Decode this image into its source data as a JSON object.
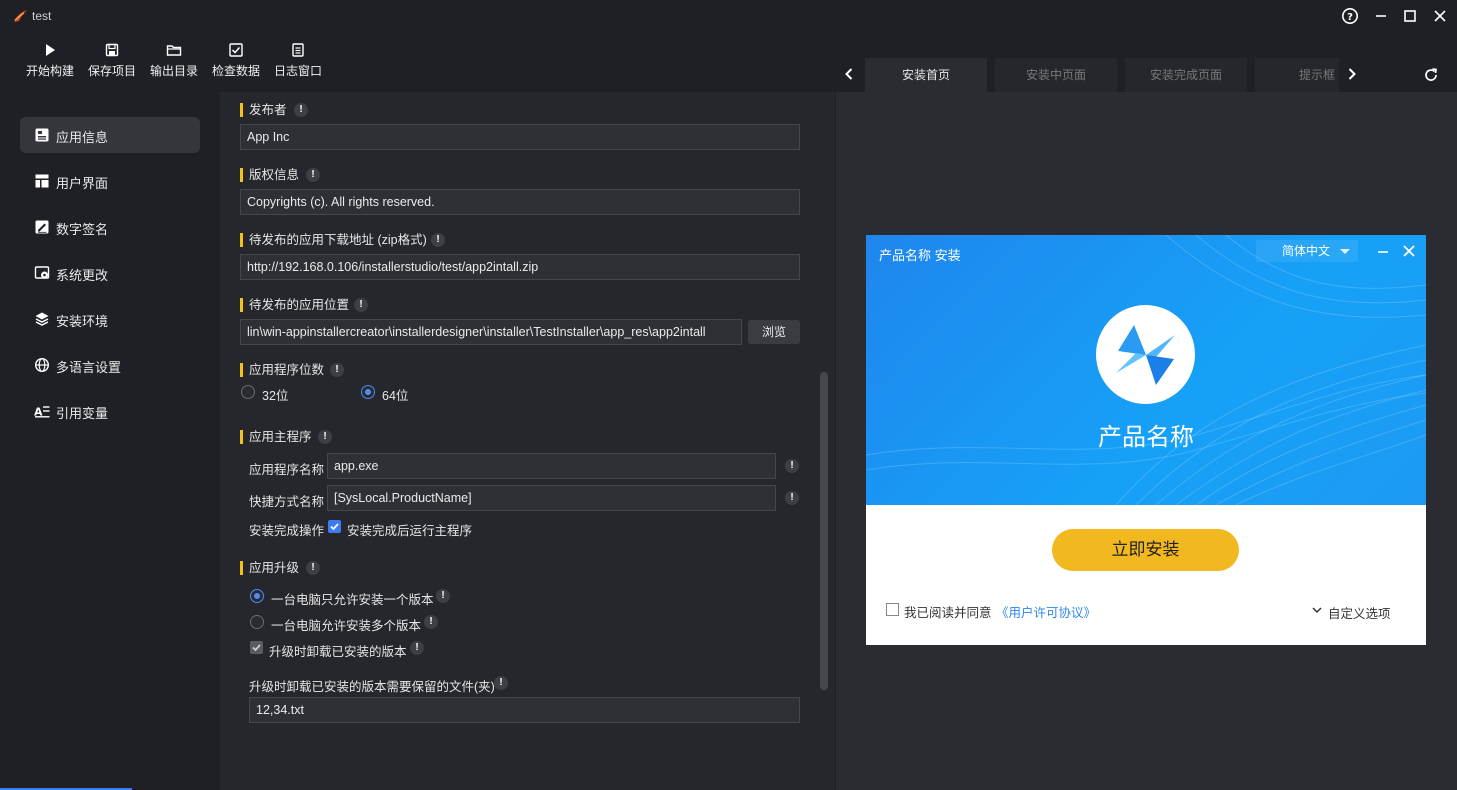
{
  "window": {
    "title": "test"
  },
  "toolbar": {
    "items": [
      {
        "label": "开始构建",
        "icon": "play-icon"
      },
      {
        "label": "保存项目",
        "icon": "save-icon"
      },
      {
        "label": "输出目录",
        "icon": "folder-icon"
      },
      {
        "label": "检查数据",
        "icon": "checklist-icon"
      },
      {
        "label": "日志窗口",
        "icon": "log-icon"
      }
    ]
  },
  "preview_tabs": {
    "items": [
      "安装首页",
      "安装中页面",
      "安装完成页面",
      "提示框"
    ],
    "active": 0
  },
  "sidebar": {
    "items": [
      {
        "label": "应用信息",
        "icon": "app-info-icon",
        "active": true
      },
      {
        "label": "用户界面",
        "icon": "layout-icon"
      },
      {
        "label": "数字签名",
        "icon": "signature-icon"
      },
      {
        "label": "系统更改",
        "icon": "system-change-icon"
      },
      {
        "label": "安装环境",
        "icon": "layers-icon"
      },
      {
        "label": "多语言设置",
        "icon": "globe-icon"
      },
      {
        "label": "引用变量",
        "icon": "variable-icon"
      }
    ]
  },
  "form": {
    "publisher": {
      "label": "发布者",
      "value": "App Inc"
    },
    "copyright": {
      "label": "版权信息",
      "value": "Copyrights (c). All rights reserved."
    },
    "download_url": {
      "label": "待发布的应用下载地址 (zip格式)",
      "value": "http://192.168.0.106/installerstudio/test/app2intall.zip"
    },
    "app_location": {
      "label": "待发布的应用位置",
      "value": "lin\\win-appinstallercreator\\installerdesigner\\installer\\TestInstaller\\app_res\\app2intall",
      "browse": "浏览"
    },
    "bitness": {
      "label": "应用程序位数",
      "options": [
        "32位",
        "64位"
      ],
      "selected": "64位"
    },
    "main_program": {
      "label": "应用主程序",
      "name_label": "应用程序名称",
      "name_value": "app.exe",
      "shortcut_label": "快捷方式名称",
      "shortcut_value": "[SysLocal.ProductName]",
      "finish_label": "安装完成操作",
      "finish_check": "安装完成后运行主程序"
    },
    "upgrade": {
      "label": "应用升级",
      "option_single": "一台电脑只允许安装一个版本",
      "option_multi": "一台电脑允许安装多个版本",
      "uninstall_check": "升级时卸载已安装的版本",
      "keep_files_label": "升级时卸载已安装的版本需要保留的文件(夹)",
      "keep_files_value": "12,34.txt"
    }
  },
  "installer": {
    "title": "产品名称 安装",
    "language": "简体中文",
    "product_name": "产品名称",
    "install_button": "立即安装",
    "agree_text": "我已阅读并同意",
    "license_link": "《用户许可协议》",
    "custom_options": "自定义选项"
  },
  "colors": {
    "accent": "#f2c21f",
    "primary": "#3d7bf0",
    "installer_blue": "#1e8ff0",
    "install_button": "#f1b81f"
  }
}
